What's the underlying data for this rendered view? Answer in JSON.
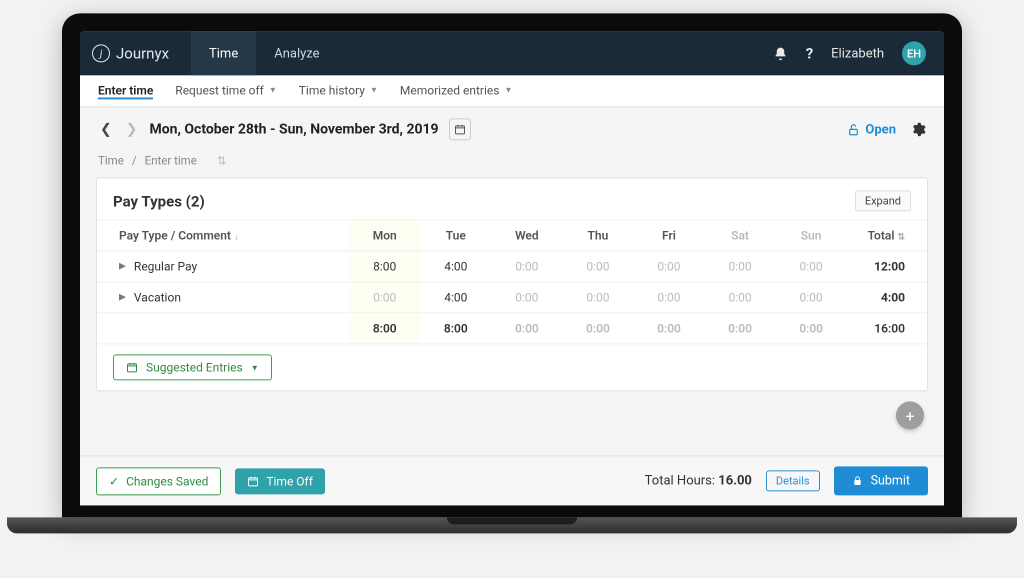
{
  "brand": {
    "name": "Journyx"
  },
  "top_tabs": [
    {
      "label": "Time",
      "active": true
    },
    {
      "label": "Analyze",
      "active": false
    }
  ],
  "user": {
    "name": "Elizabeth",
    "initials": "EH"
  },
  "subnav": [
    {
      "label": "Enter time",
      "active": true,
      "dropdown": false
    },
    {
      "label": "Request time off",
      "active": false,
      "dropdown": true
    },
    {
      "label": "Time history",
      "active": false,
      "dropdown": true
    },
    {
      "label": "Memorized entries",
      "active": false,
      "dropdown": true
    }
  ],
  "date_range": "Mon, October 28th - Sun, November 3rd, 2019",
  "status": {
    "label": "Open"
  },
  "breadcrumb": [
    "Time",
    "Enter time"
  ],
  "card": {
    "title": "Pay Types (2)",
    "expand_label": "Expand",
    "first_col_header": "Pay Type / Comment",
    "day_headers": [
      "Mon",
      "Tue",
      "Wed",
      "Thu",
      "Fri",
      "Sat",
      "Sun"
    ],
    "total_header": "Total",
    "rows": [
      {
        "label": "Regular Pay",
        "values": [
          "8:00",
          "4:00",
          "0:00",
          "0:00",
          "0:00",
          "0:00",
          "0:00"
        ],
        "total": "12:00"
      },
      {
        "label": "Vacation",
        "values": [
          "0:00",
          "4:00",
          "0:00",
          "0:00",
          "0:00",
          "0:00",
          "0:00"
        ],
        "total": "4:00"
      }
    ],
    "totals_row": {
      "values": [
        "8:00",
        "8:00",
        "0:00",
        "0:00",
        "0:00",
        "0:00",
        "0:00"
      ],
      "total": "16:00"
    },
    "suggested_label": "Suggested Entries"
  },
  "footer": {
    "saved_label": "Changes Saved",
    "time_off_label": "Time Off",
    "total_hours_label": "Total Hours:",
    "total_hours_value": "16.00",
    "details_label": "Details",
    "submit_label": "Submit"
  }
}
